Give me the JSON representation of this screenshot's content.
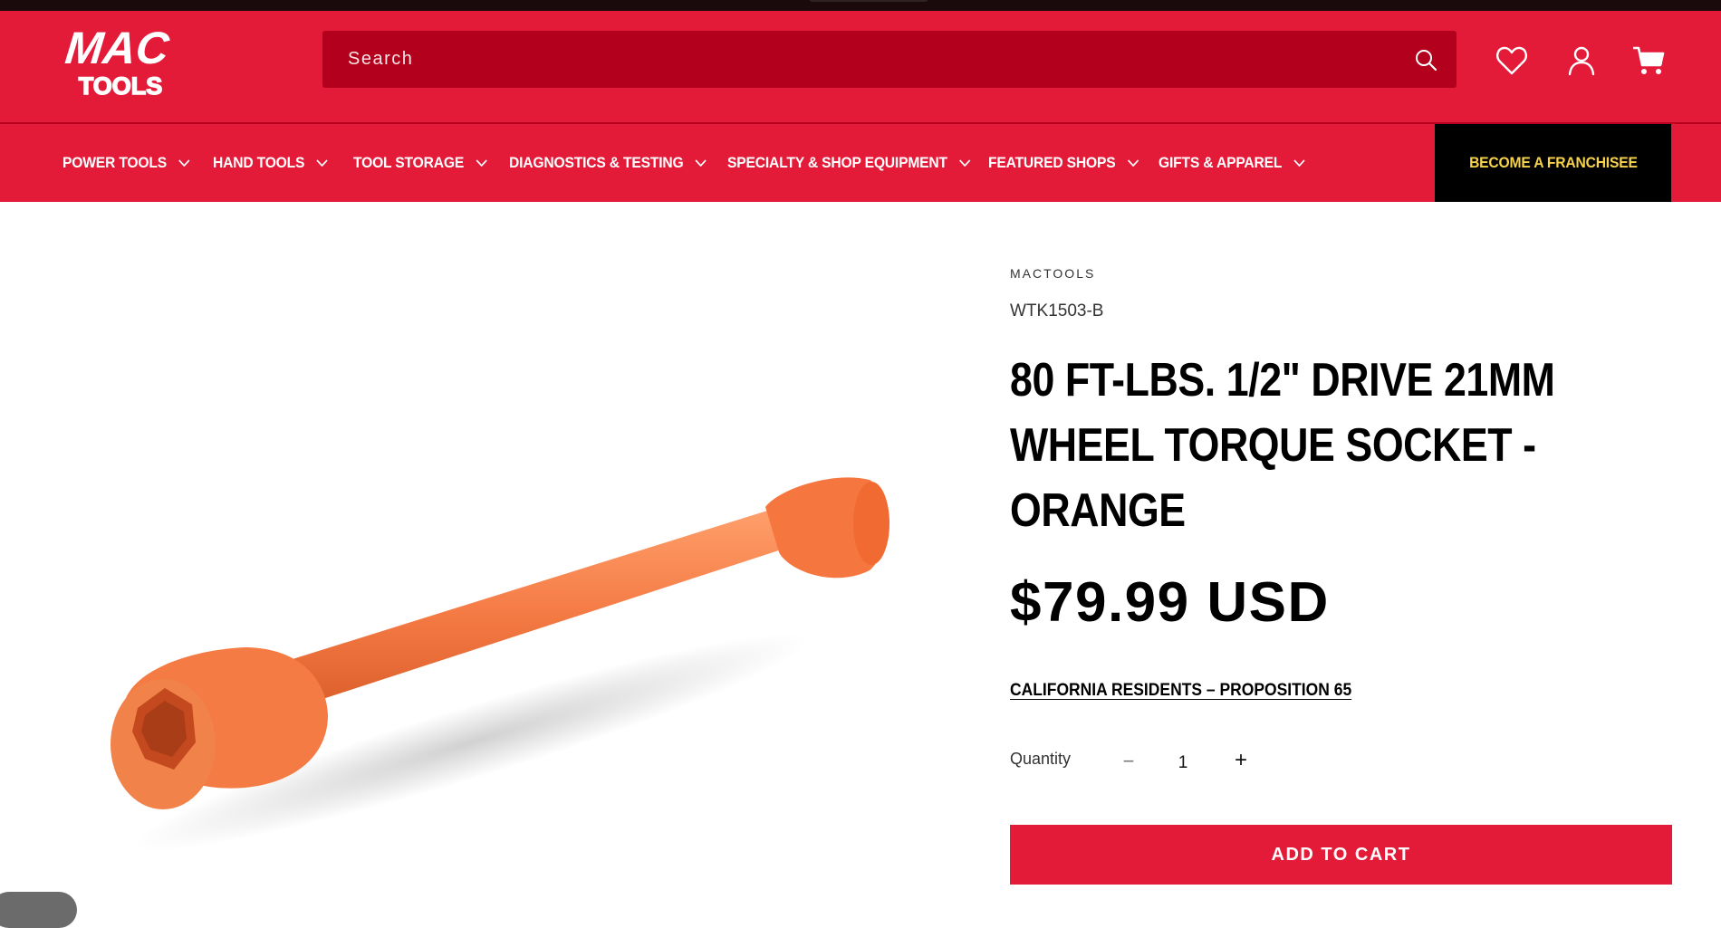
{
  "brand": {
    "logo_line1": "MAC",
    "logo_line2": "TOOLS"
  },
  "search": {
    "placeholder": "Search"
  },
  "header_icons": [
    "heart-icon",
    "account-icon",
    "cart-icon"
  ],
  "nav": {
    "items": [
      {
        "label": "POWER TOOLS"
      },
      {
        "label": "HAND TOOLS"
      },
      {
        "label": "TOOL STORAGE"
      },
      {
        "label": "DIAGNOSTICS & TESTING"
      },
      {
        "label": "SPECIALTY & SHOP EQUIPMENT"
      },
      {
        "label": "FEATURED SHOPS"
      },
      {
        "label": "GIFTS & APPAREL"
      }
    ],
    "cta": "BECOME A FRANCHISEE"
  },
  "product": {
    "vendor": "MACTOOLS",
    "sku": "WTK1503-B",
    "title_lines": [
      "80 FT-LBS. 1/2\" DRIVE 21MM",
      "WHEEL TORQUE SOCKET -",
      "ORANGE"
    ],
    "price": "$79.99 USD",
    "prop65_link": "CALIFORNIA RESIDENTS – PROPOSITION 65",
    "quantity_label": "Quantity",
    "quantity_value": "1",
    "minus": "−",
    "plus": "+",
    "add_to_cart": "ADD TO CART",
    "image_color": "#f57b45"
  },
  "colors": {
    "brand_red": "#e31b39",
    "search_red": "#b2001d",
    "franchise_bg": "#000000",
    "franchise_text": "#f6d34a"
  }
}
